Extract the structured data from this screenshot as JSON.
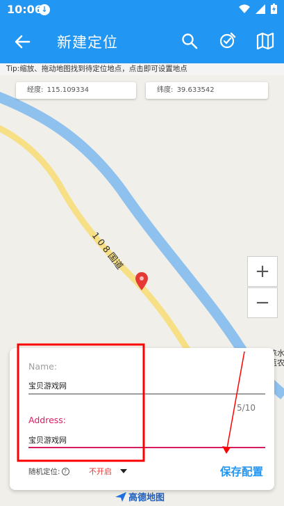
{
  "status_bar": {
    "time": "10:06"
  },
  "app_bar": {
    "title": "新建定位"
  },
  "tip": "Tip:缩放、拖动地图找到待定位地点，点击即可设置地点",
  "coords": {
    "lng_label": "经度:",
    "lng_value": "115.109334",
    "lat_label": "纬度:",
    "lat_value": "39.633542"
  },
  "map": {
    "road_label": "1 0 8 国道",
    "place_label_1": "涞水",
    "place_label_2": "蓝农",
    "zoom_in": "+",
    "zoom_out": "−",
    "logo_text": "高德地图"
  },
  "form": {
    "name_label": "Name:",
    "name_value": "宝贝游戏网",
    "counter": "5/10",
    "address_label": "Address:",
    "address_value": "宝贝游戏网",
    "random_label": "随机定位:",
    "random_value": "不开启",
    "save_label": "保存配置"
  },
  "colors": {
    "primary": "#2196f3",
    "accent": "#d81b60",
    "annotation": "#ff0000"
  }
}
